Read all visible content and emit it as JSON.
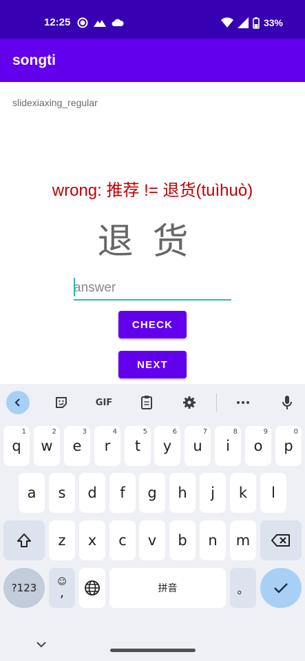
{
  "status": {
    "time": "12:25",
    "battery": "33%",
    "left_icons": [
      "signal-app-icon",
      "mountain-icon",
      "cloud-icon"
    ],
    "right_icons": [
      "wifi-icon",
      "cell-signal-icon",
      "battery-icon"
    ]
  },
  "appbar": {
    "title": "songti"
  },
  "main": {
    "font_label": "slidexiaxing_regular",
    "result": "wrong: 推荐 != 退货(tuìhuò)",
    "glyph": "退货",
    "answer_placeholder": "answer",
    "answer_value": "",
    "check_label": "CHECK",
    "next_label": "NEXT"
  },
  "keyboard": {
    "toolbar": {
      "gif": "GIF",
      "icons": [
        "back-chevron-icon",
        "sticker-icon",
        "gif-icon",
        "clipboard-icon",
        "settings-icon",
        "more-icon",
        "microphone-icon"
      ]
    },
    "row1": [
      {
        "k": "q",
        "h": "1"
      },
      {
        "k": "w",
        "h": "2"
      },
      {
        "k": "e",
        "h": "3"
      },
      {
        "k": "r",
        "h": "4"
      },
      {
        "k": "t",
        "h": "5"
      },
      {
        "k": "y",
        "h": "6"
      },
      {
        "k": "u",
        "h": "7"
      },
      {
        "k": "i",
        "h": "8"
      },
      {
        "k": "o",
        "h": "9"
      },
      {
        "k": "p",
        "h": "0"
      }
    ],
    "row2": [
      "a",
      "s",
      "d",
      "f",
      "g",
      "h",
      "j",
      "k",
      "l"
    ],
    "row3": [
      "z",
      "x",
      "c",
      "v",
      "b",
      "n",
      "m"
    ],
    "sym_label": "?123",
    "comma": ",",
    "space_label": "拼音",
    "period": "。"
  },
  "colors": {
    "statusbar": "#3700b3",
    "appbar": "#6200ee",
    "button": "#6200ee",
    "error_text": "#c00000",
    "input_underline": "#26bfa8",
    "keyboard_bg": "#eef0f5",
    "accent_key": "#a8d0f5"
  }
}
